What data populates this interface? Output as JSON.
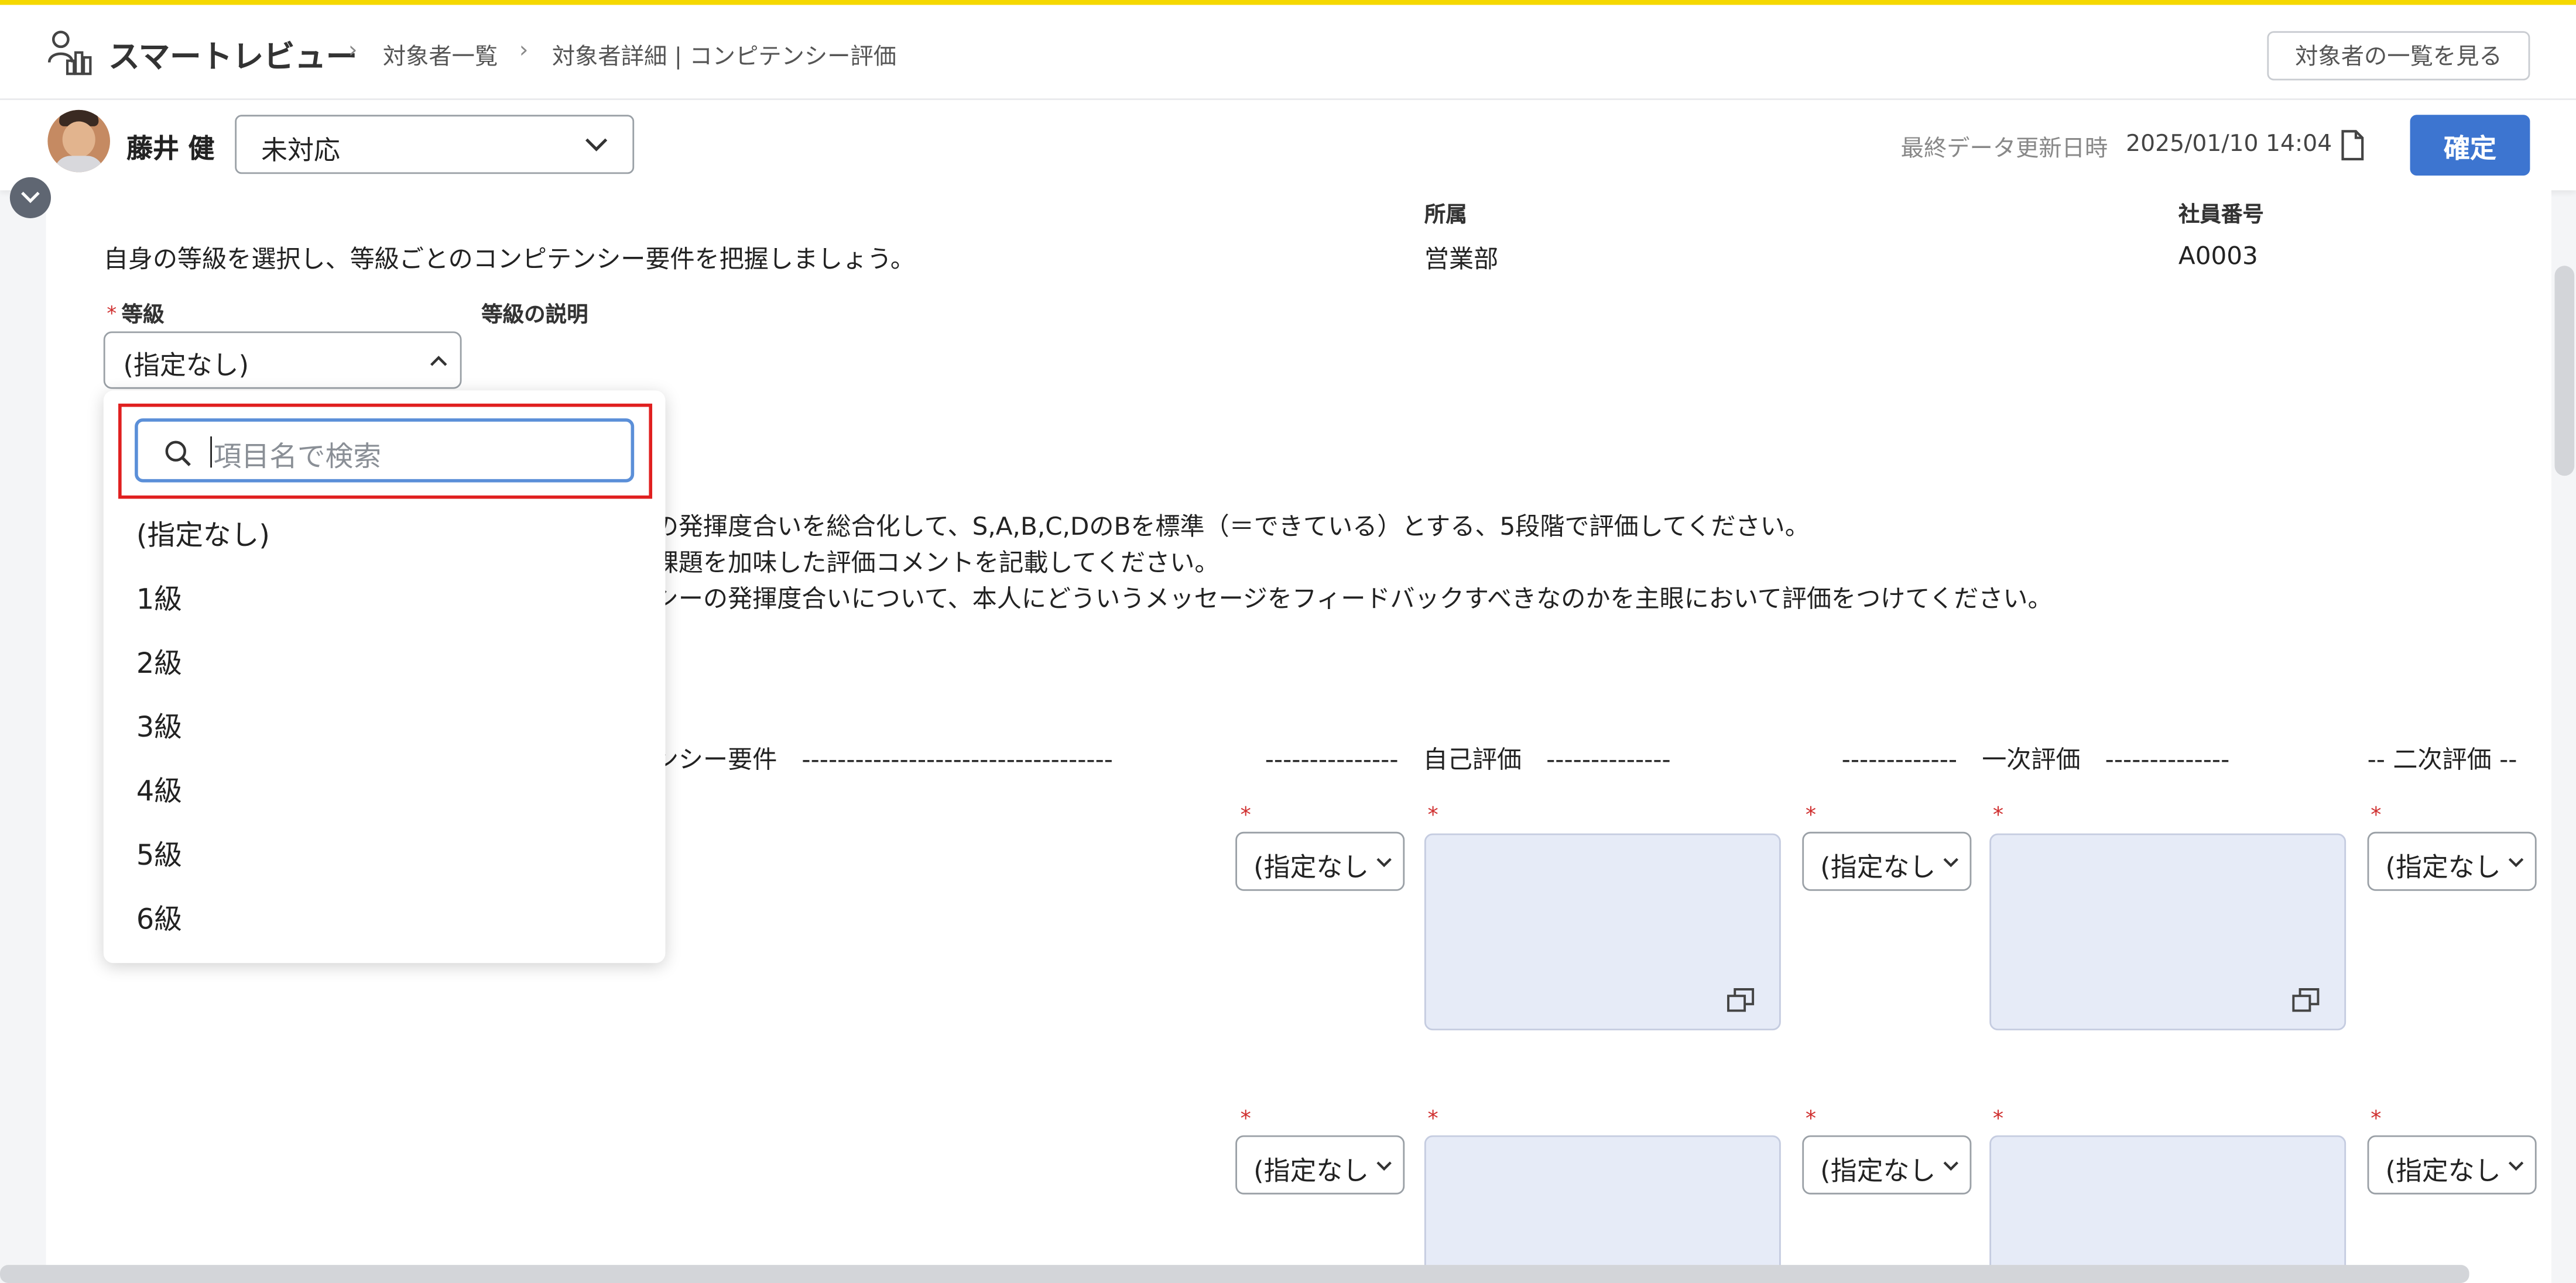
{
  "header": {
    "app_name": "スマートレビュー",
    "breadcrumbs": [
      "対象者一覧",
      "対象者詳細 | コンピテンシー評価"
    ],
    "view_list_button": "対象者の一覧を見る"
  },
  "subbar": {
    "user_name": "藤井 健",
    "status_value": "未対応",
    "last_updated_label": "最終データ更新日時",
    "last_updated_value": "2025/01/10 14:04",
    "confirm_button": "確定"
  },
  "info": {
    "dept_label": "所属",
    "dept_value": "営業部",
    "emp_no_label": "社員番号",
    "emp_no_value": "A0003",
    "intro_text": "自身の等級を選択し、等級ごとのコンピテンシー要件を把握しましょう。"
  },
  "grade": {
    "required_mark": "*",
    "label": "等級",
    "value": "(指定なし)",
    "description_label": "等級の説明"
  },
  "dropdown": {
    "search_placeholder": "項目名で検索",
    "options": [
      "(指定なし)",
      "1級",
      "2級",
      "3級",
      "4級",
      "5級",
      "6級"
    ]
  },
  "instructions": [
    "の発揮度合いを総合化して、S,A,B,C,DのBを標準（＝できている）とする、5段階で評価してください。",
    "課題を加味した評価コメントを記載してください。",
    "シーの発揮度合いについて、本人にどういうメッセージをフィードバックすべきなのかを主眼において評価をつけてください。"
  ],
  "columns": {
    "requirement": "ンシー要件　-----------------------------------",
    "self_eval": "---------------　自己評価　--------------",
    "first_eval": "-------------　一次評価　--------------",
    "second_eval": "-- 二次評価 --"
  },
  "eval_select_value": "(指定なし",
  "colors": {
    "accent": "#3d75d0",
    "top_bar": "#f5d800",
    "highlight": "#e02020",
    "textarea_bg": "#e6ebf7"
  }
}
